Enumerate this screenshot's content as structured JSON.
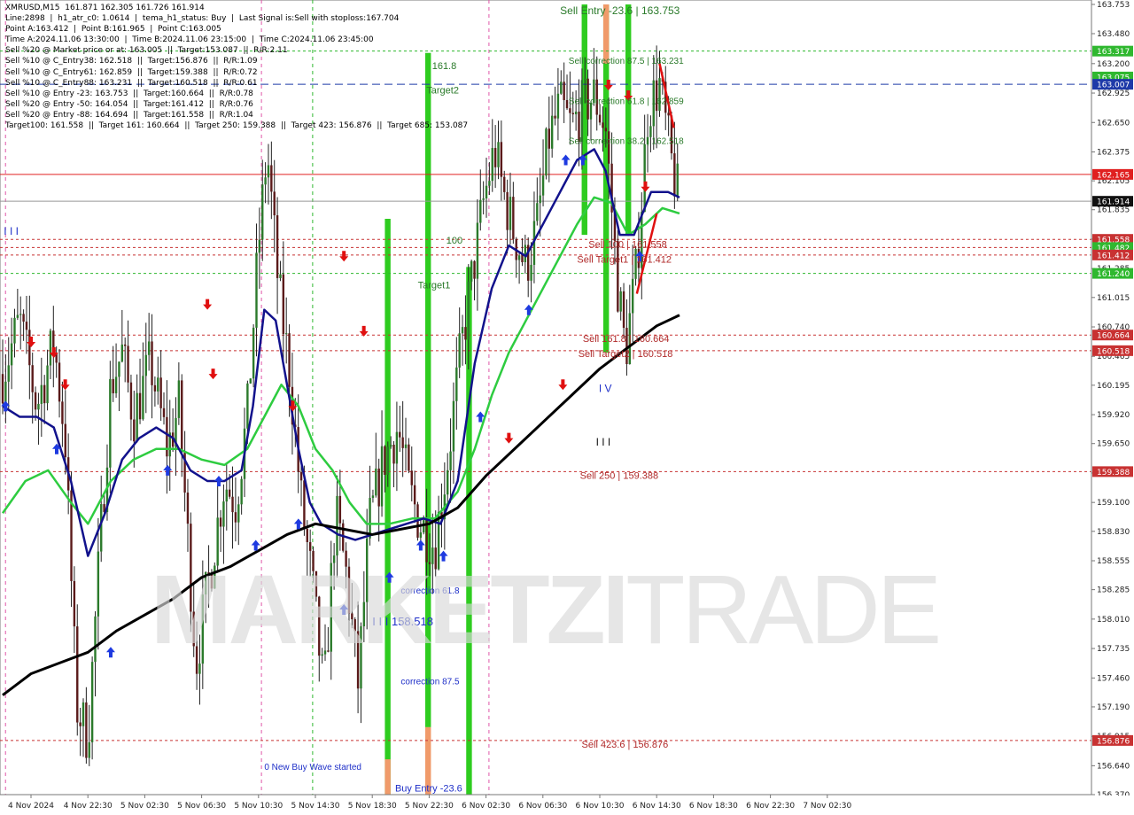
{
  "header": {
    "lines": [
      "XMRUSD,M15  161.871 162.305 161.726 161.914",
      "Line:2898  |  h1_atr_c0: 1.0614  |  tema_h1_status: Buy  |  Last Signal is:Sell with stoploss:167.704",
      "Point A:163.412  |  Point B:161.965  |  Point C:163.005",
      "Time A:2024.11.06 13:30:00  |  Time B:2024.11.06 23:15:00  |  Time C:2024.11.06 23:45:00",
      "Sell %20 @ Market price or at: 163.005  ||  Target:153.087  ||  R/R:2.11",
      "Sell %10 @ C_Entry38: 162.518  ||  Target:156.876  ||  R/R:1.09",
      "Sell %10 @ C_Entry61: 162.859  ||  Target:159.388  ||  R/R:0.72",
      "Sell %10 @ C_Entry88: 163.231  ||  Target:160.518  ||  R/R:0.61",
      "Sell %10 @ Entry -23: 163.753  ||  Target:160.664  ||  R/R:0.78",
      "Sell %20 @ Entry -50: 164.054  ||  Target:161.412  ||  R/R:0.76",
      "Sell %20 @ Entry -88: 164.694  ||  Target:161.558  ||  R/R:1.04",
      "Target100: 161.558  ||  Target 161: 160.664  ||  Target 250: 159.388  ||  Target 423: 156.876  ||  Target 685: 153.087"
    ]
  },
  "watermark": {
    "bold": "MARKETZI",
    "light": "TRADE"
  },
  "chart_data": {
    "type": "candlestick",
    "symbol": "XMRUSD",
    "timeframe": "M15",
    "ylim": [
      156.37,
      163.753
    ],
    "y_ticks": [
      163.753,
      163.48,
      163.2,
      162.925,
      162.65,
      162.375,
      162.105,
      161.835,
      161.56,
      161.285,
      161.015,
      160.74,
      160.465,
      160.195,
      159.92,
      159.65,
      159.375,
      159.1,
      158.83,
      158.555,
      158.285,
      158.01,
      157.735,
      157.46,
      157.19,
      156.915,
      156.64,
      156.37
    ],
    "x_labels": [
      "4 Nov 2024",
      "4 Nov 22:30",
      "5 Nov 02:30",
      "5 Nov 06:30",
      "5 Nov 10:30",
      "5 Nov 14:30",
      "5 Nov 18:30",
      "5 Nov 22:30",
      "6 Nov 02:30",
      "6 Nov 06:30",
      "6 Nov 10:30",
      "6 Nov 14:30",
      "6 Nov 18:30",
      "6 Nov 22:30",
      "7 Nov 02:30"
    ],
    "price_badges": [
      {
        "value": "163.317",
        "color": "#2fb82f"
      },
      {
        "value": "163.075",
        "color": "#2fb82f"
      },
      {
        "value": "163.007",
        "color": "#1e3aa8"
      },
      {
        "value": "162.165",
        "color": "#e02020"
      },
      {
        "value": "161.914",
        "color": "#111111"
      },
      {
        "value": "161.558",
        "color": "#c83232"
      },
      {
        "value": "161.482",
        "color": "#2fb82f"
      },
      {
        "value": "161.412",
        "color": "#c83232"
      },
      {
        "value": "161.240",
        "color": "#2fb82f"
      },
      {
        "value": "160.664",
        "color": "#c83232"
      },
      {
        "value": "160.518",
        "color": "#c83232"
      },
      {
        "value": "159.388",
        "color": "#c83232"
      },
      {
        "value": "156.876",
        "color": "#c83232"
      }
    ],
    "hlines": [
      {
        "value": 163.317,
        "color": "#2fb82f",
        "dash": "3,3"
      },
      {
        "value": 163.007,
        "color": "#1e3aa8",
        "dash": "9,5"
      },
      {
        "value": 162.165,
        "color": "#e02020",
        "dash": ""
      },
      {
        "value": 161.914,
        "color": "#999999",
        "dash": ""
      },
      {
        "value": 161.558,
        "color": "#c83232",
        "dash": "3,3"
      },
      {
        "value": 161.482,
        "color": "#c83232",
        "dash": "3,3"
      },
      {
        "value": 161.412,
        "color": "#c83232",
        "dash": "3,3"
      },
      {
        "value": 161.24,
        "color": "#2fb82f",
        "dash": "3,3"
      },
      {
        "value": 160.664,
        "color": "#c83232",
        "dash": "3,3"
      },
      {
        "value": 160.518,
        "color": "#c83232",
        "dash": "3,3"
      },
      {
        "value": 159.388,
        "color": "#c83232",
        "dash": "3,3"
      },
      {
        "value": 156.876,
        "color": "#c83232",
        "dash": "3,3"
      }
    ],
    "zones": [
      {
        "x0": 6.72,
        "x1": 6.82,
        "y0": 156.37,
        "y1": 161.75,
        "color": "#2ecc1f"
      },
      {
        "x0": 6.72,
        "x1": 6.82,
        "y0": 156.37,
        "y1": 156.7,
        "color": "#f09a6a"
      },
      {
        "x0": 7.43,
        "x1": 7.53,
        "y0": 157.0,
        "y1": 163.3,
        "color": "#2ecc1f"
      },
      {
        "x0": 7.43,
        "x1": 7.53,
        "y0": 156.37,
        "y1": 157.0,
        "color": "#f09a6a"
      },
      {
        "x0": 8.15,
        "x1": 8.25,
        "y0": 156.37,
        "y1": 161.3,
        "color": "#2ecc1f"
      },
      {
        "x0": 10.18,
        "x1": 10.28,
        "y0": 161.6,
        "y1": 163.753,
        "color": "#2ecc1f"
      },
      {
        "x0": 10.56,
        "x1": 10.66,
        "y0": 160.5,
        "y1": 163.753,
        "color": "#2ecc1f"
      },
      {
        "x0": 10.56,
        "x1": 10.66,
        "y0": 163.2,
        "y1": 163.753,
        "color": "#f09a6a"
      },
      {
        "x0": 10.95,
        "x1": 11.05,
        "y0": 161.6,
        "y1": 163.753,
        "color": "#2ecc1f"
      }
    ],
    "vlines": [
      {
        "x": 0.05,
        "color": "#e056a8"
      },
      {
        "x": 4.55,
        "color": "#e056a8"
      },
      {
        "x": 5.45,
        "color": "#2fb82f"
      },
      {
        "x": 8.55,
        "color": "#e056a8"
      }
    ],
    "ohlc_points": [
      [
        0,
        160.3
      ],
      [
        0.3,
        160.8
      ],
      [
        0.6,
        160.0
      ],
      [
        0.9,
        160.6
      ],
      [
        1.1,
        159.7
      ],
      [
        1.3,
        157.2
      ],
      [
        1.5,
        156.9
      ],
      [
        1.7,
        158.6
      ],
      [
        1.9,
        160.2
      ],
      [
        2.1,
        160.5
      ],
      [
        2.3,
        159.9
      ],
      [
        2.6,
        160.4
      ],
      [
        2.9,
        159.6
      ],
      [
        3.1,
        160.0
      ],
      [
        3.4,
        157.6
      ],
      [
        3.6,
        158.3
      ],
      [
        3.9,
        159.3
      ],
      [
        4.1,
        159.1
      ],
      [
        4.3,
        159.9
      ],
      [
        4.5,
        161.5
      ],
      [
        4.65,
        162.4
      ],
      [
        4.85,
        161.1
      ],
      [
        5.05,
        160.3
      ],
      [
        5.25,
        159.1
      ],
      [
        5.45,
        158.3
      ],
      [
        5.65,
        157.3
      ],
      [
        5.85,
        159.0
      ],
      [
        6.05,
        158.4
      ],
      [
        6.25,
        157.4
      ],
      [
        6.45,
        158.9
      ],
      [
        6.7,
        159.5
      ],
      [
        6.95,
        159.8
      ],
      [
        7.15,
        159.2
      ],
      [
        7.35,
        158.9
      ],
      [
        7.6,
        158.7
      ],
      [
        7.85,
        159.6
      ],
      [
        8.05,
        160.5
      ],
      [
        8.25,
        161.2
      ],
      [
        8.45,
        161.9
      ],
      [
        8.65,
        162.4
      ],
      [
        8.8,
        162.0
      ],
      [
        9.0,
        161.6
      ],
      [
        9.2,
        161.3
      ],
      [
        9.4,
        161.7
      ],
      [
        9.6,
        162.5
      ],
      [
        9.8,
        162.8
      ],
      [
        10.0,
        162.6
      ],
      [
        10.2,
        162.8
      ],
      [
        10.4,
        162.9
      ],
      [
        10.6,
        162.6
      ],
      [
        10.8,
        161.2
      ],
      [
        10.95,
        160.5
      ],
      [
        11.15,
        161.3
      ],
      [
        11.35,
        162.8
      ],
      [
        11.55,
        163.0
      ],
      [
        11.75,
        162.3
      ],
      [
        11.9,
        161.9
      ]
    ],
    "ema_fast": [
      [
        0,
        160.0
      ],
      [
        0.3,
        159.9
      ],
      [
        0.6,
        159.9
      ],
      [
        0.9,
        159.8
      ],
      [
        1.2,
        159.3
      ],
      [
        1.5,
        158.6
      ],
      [
        1.8,
        159.0
      ],
      [
        2.1,
        159.5
      ],
      [
        2.4,
        159.7
      ],
      [
        2.7,
        159.8
      ],
      [
        3.0,
        159.7
      ],
      [
        3.3,
        159.4
      ],
      [
        3.6,
        159.3
      ],
      [
        3.9,
        159.3
      ],
      [
        4.2,
        159.4
      ],
      [
        4.4,
        160.0
      ],
      [
        4.6,
        160.9
      ],
      [
        4.8,
        160.8
      ],
      [
        5.0,
        160.2
      ],
      [
        5.2,
        159.6
      ],
      [
        5.4,
        159.1
      ],
      [
        5.6,
        158.9
      ],
      [
        5.9,
        158.8
      ],
      [
        6.2,
        158.75
      ],
      [
        6.5,
        158.8
      ],
      [
        6.8,
        158.85
      ],
      [
        7.1,
        158.9
      ],
      [
        7.4,
        158.95
      ],
      [
        7.7,
        158.9
      ],
      [
        8.0,
        159.3
      ],
      [
        8.3,
        160.4
      ],
      [
        8.6,
        161.1
      ],
      [
        8.9,
        161.5
      ],
      [
        9.2,
        161.4
      ],
      [
        9.5,
        161.7
      ],
      [
        9.8,
        162.0
      ],
      [
        10.1,
        162.3
      ],
      [
        10.4,
        162.4
      ],
      [
        10.6,
        162.2
      ],
      [
        10.85,
        161.6
      ],
      [
        11.1,
        161.6
      ],
      [
        11.4,
        162.0
      ],
      [
        11.7,
        162.0
      ],
      [
        11.9,
        161.95
      ]
    ],
    "ema_mid": [
      [
        0,
        159.0
      ],
      [
        0.4,
        159.3
      ],
      [
        0.8,
        159.4
      ],
      [
        1.2,
        159.1
      ],
      [
        1.5,
        158.9
      ],
      [
        1.9,
        159.3
      ],
      [
        2.3,
        159.5
      ],
      [
        2.7,
        159.6
      ],
      [
        3.1,
        159.6
      ],
      [
        3.5,
        159.5
      ],
      [
        3.9,
        159.45
      ],
      [
        4.3,
        159.6
      ],
      [
        4.6,
        159.9
      ],
      [
        4.9,
        160.2
      ],
      [
        5.2,
        160.0
      ],
      [
        5.5,
        159.6
      ],
      [
        5.8,
        159.4
      ],
      [
        6.1,
        159.1
      ],
      [
        6.4,
        158.9
      ],
      [
        6.8,
        158.9
      ],
      [
        7.2,
        158.95
      ],
      [
        7.6,
        158.95
      ],
      [
        8.0,
        159.2
      ],
      [
        8.3,
        159.6
      ],
      [
        8.6,
        160.1
      ],
      [
        8.9,
        160.5
      ],
      [
        9.2,
        160.8
      ],
      [
        9.5,
        161.1
      ],
      [
        9.8,
        161.4
      ],
      [
        10.1,
        161.7
      ],
      [
        10.4,
        161.95
      ],
      [
        10.7,
        161.9
      ],
      [
        11.0,
        161.6
      ],
      [
        11.3,
        161.7
      ],
      [
        11.6,
        161.85
      ],
      [
        11.9,
        161.8
      ]
    ],
    "ema_slow": [
      [
        0,
        157.3
      ],
      [
        0.5,
        157.5
      ],
      [
        1.0,
        157.6
      ],
      [
        1.5,
        157.7
      ],
      [
        2.0,
        157.9
      ],
      [
        2.5,
        158.05
      ],
      [
        3.0,
        158.2
      ],
      [
        3.5,
        158.4
      ],
      [
        4.0,
        158.5
      ],
      [
        4.5,
        158.65
      ],
      [
        5.0,
        158.8
      ],
      [
        5.5,
        158.9
      ],
      [
        6.0,
        158.85
      ],
      [
        6.5,
        158.8
      ],
      [
        7.0,
        158.85
      ],
      [
        7.5,
        158.9
      ],
      [
        8.0,
        159.05
      ],
      [
        8.5,
        159.35
      ],
      [
        9.0,
        159.6
      ],
      [
        9.5,
        159.85
      ],
      [
        10.0,
        160.1
      ],
      [
        10.5,
        160.35
      ],
      [
        11.0,
        160.55
      ],
      [
        11.5,
        160.75
      ],
      [
        11.9,
        160.85
      ]
    ],
    "annotations": [
      {
        "text": "Sell Entry -23.6 | 163.753",
        "x": 9.8,
        "y": 163.66,
        "color": "#2a7a2a",
        "size": 12
      },
      {
        "text": "Sell correction 87.5 | 163.231",
        "x": 9.95,
        "y": 163.2,
        "color": "#2a7a2a",
        "size": 10
      },
      {
        "text": "Sell correction 61.8 | 162.859",
        "x": 9.95,
        "y": 162.82,
        "color": "#2a7a2a",
        "size": 10
      },
      {
        "text": "Sell correction 38.2 | 162.518",
        "x": 9.95,
        "y": 162.45,
        "color": "#2a7a2a",
        "size": 10
      },
      {
        "text": "Sell 100 | 161.558",
        "x": 10.3,
        "y": 161.48,
        "color": "#b02a2a",
        "size": 11
      },
      {
        "text": "Sell Target1 | 161.412",
        "x": 10.1,
        "y": 161.34,
        "color": "#b02a2a",
        "size": 11
      },
      {
        "text": "Sell 161.8 | 160.664",
        "x": 10.2,
        "y": 160.6,
        "color": "#b02a2a",
        "size": 11
      },
      {
        "text": "Sell Target2 | 160.518",
        "x": 10.12,
        "y": 160.46,
        "color": "#b02a2a",
        "size": 11
      },
      {
        "text": "Sell 250 | 159.388",
        "x": 10.15,
        "y": 159.32,
        "color": "#b02a2a",
        "size": 11
      },
      {
        "text": "Sell 423.6 | 156.876",
        "x": 10.18,
        "y": 156.81,
        "color": "#b02a2a",
        "size": 11
      },
      {
        "text": "161.8",
        "x": 7.55,
        "y": 163.15,
        "color": "#2a7a2a",
        "size": 11
      },
      {
        "text": "Target2",
        "x": 7.45,
        "y": 162.92,
        "color": "#2a7a2a",
        "size": 11
      },
      {
        "text": "100",
        "x": 7.8,
        "y": 161.52,
        "color": "#2a7a2a",
        "size": 11
      },
      {
        "text": "Target1",
        "x": 7.3,
        "y": 161.1,
        "color": "#2a7a2a",
        "size": 11
      },
      {
        "text": "correction 61.8",
        "x": 7.0,
        "y": 158.25,
        "color": "#1e2fc8",
        "size": 10
      },
      {
        "text": "correction 87.5",
        "x": 7.0,
        "y": 157.4,
        "color": "#1e2fc8",
        "size": 10
      },
      {
        "text": "I I I 158.518",
        "x": 6.5,
        "y": 157.95,
        "color": "#1e2fc8",
        "size": 13
      },
      {
        "text": "Buy Entry -23.6",
        "x": 6.9,
        "y": 156.4,
        "color": "#1e2fc8",
        "size": 11
      },
      {
        "text": "0 New Buy Wave started",
        "x": 4.6,
        "y": 156.6,
        "color": "#1e2fc8",
        "size": 10
      },
      {
        "text": "I V",
        "x": 10.48,
        "y": 160.13,
        "color": "#1e2fc8",
        "size": 12
      },
      {
        "text": "I I I",
        "x": 10.43,
        "y": 159.63,
        "color": "#111111",
        "size": 12
      },
      {
        "text": "I I I",
        "x": 0.02,
        "y": 161.6,
        "color": "#1e2fc8",
        "size": 12
      }
    ]
  }
}
